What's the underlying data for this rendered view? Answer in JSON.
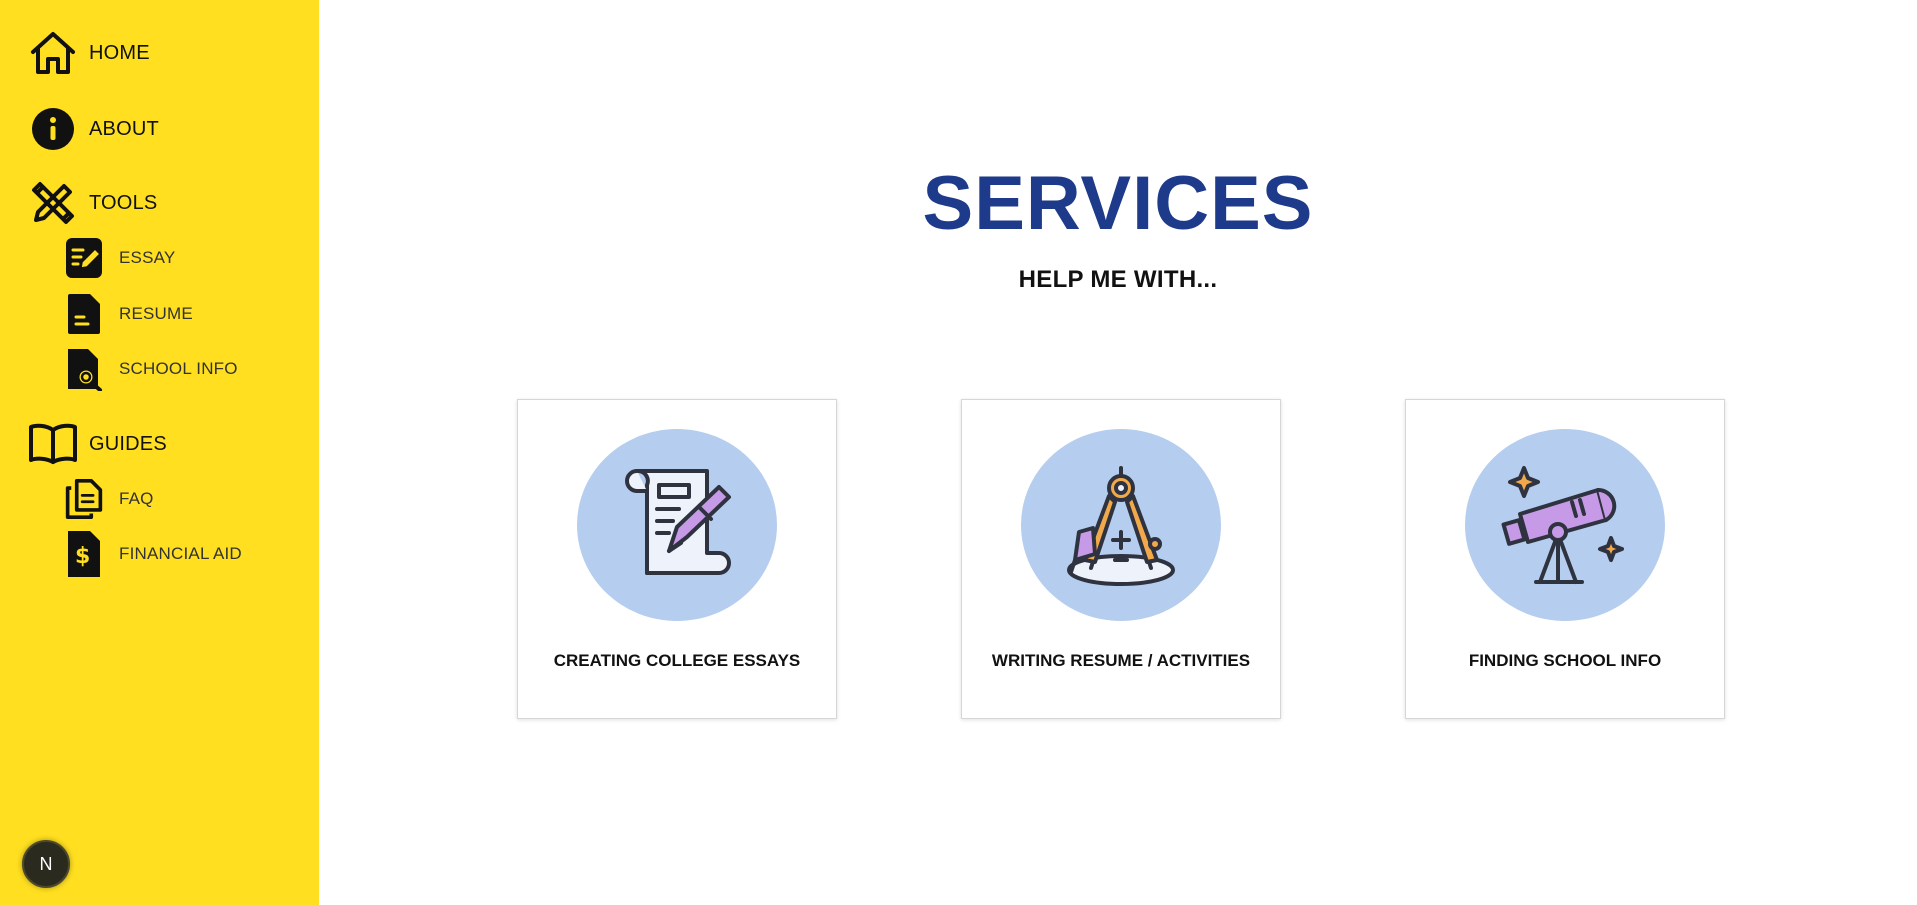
{
  "sidebar": {
    "home": "HOME",
    "about": "ABOUT",
    "tools": "TOOLS",
    "essay": "ESSAY",
    "resume": "RESUME",
    "school_info": "SCHOOL INFO",
    "guides": "GUIDES",
    "faq": "FAQ",
    "financial_aid": "FINANCIAL AID",
    "badge": "N"
  },
  "main": {
    "title": "SERVICES",
    "subtitle": "HELP ME WITH...",
    "cards": [
      {
        "label": "CREATING COLLEGE ESSAYS",
        "icon": "essay-scroll-pen-icon"
      },
      {
        "label": "WRITING RESUME / ACTIVITIES",
        "icon": "compass-pencil-icon"
      },
      {
        "label": "FINDING SCHOOL INFO",
        "icon": "telescope-icon"
      }
    ]
  },
  "colors": {
    "sidebar_bg": "#ffdf20",
    "title": "#1e3a8a",
    "circle_bg": "#b5cdee",
    "accent_purple": "#b07cf0",
    "accent_orange": "#f2a94b"
  }
}
